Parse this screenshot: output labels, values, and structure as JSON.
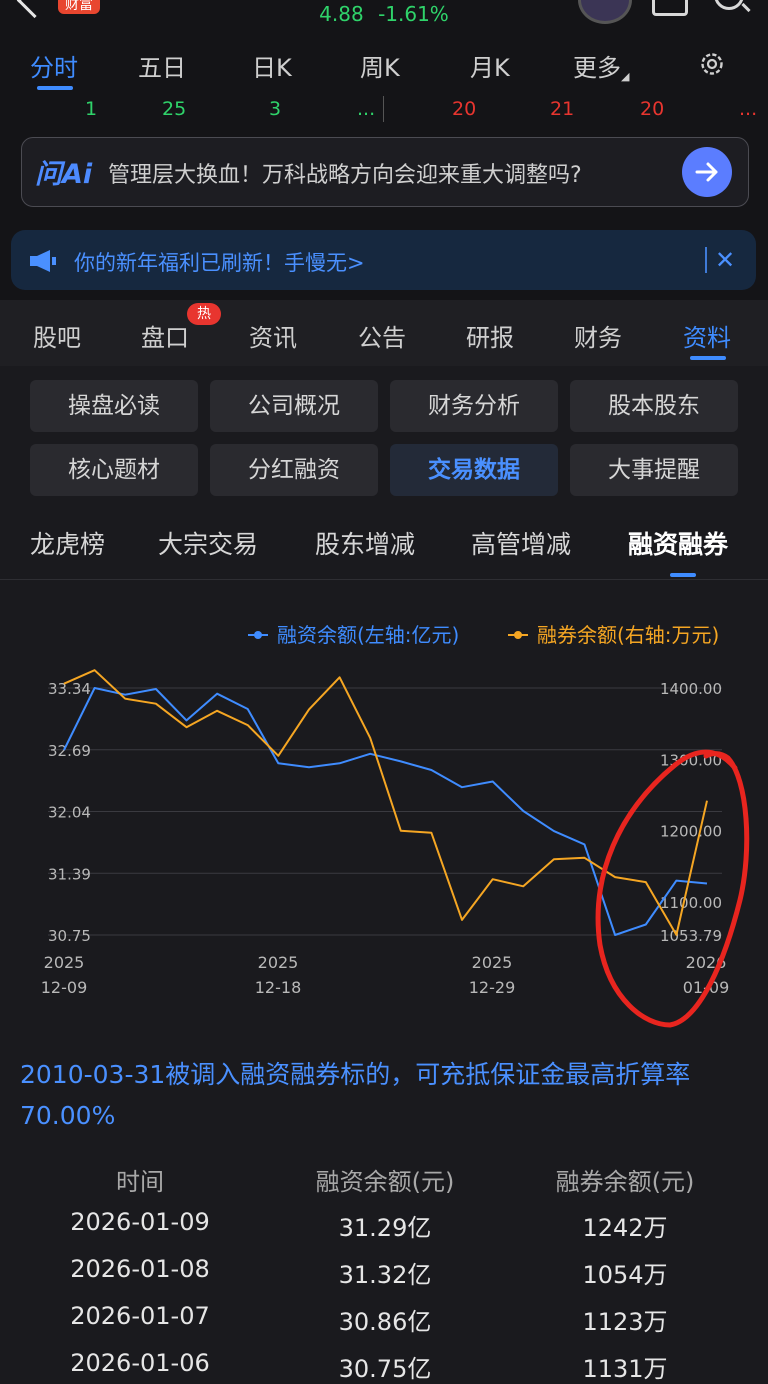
{
  "status": {
    "brand_badge": "财富",
    "price": "4.88",
    "change": "-1.61%"
  },
  "chart_tabs": {
    "items": [
      "分时",
      "五日",
      "日K",
      "周K",
      "月K",
      "更多"
    ],
    "active": "分时"
  },
  "numbers_row": {
    "left": [
      "1",
      "25",
      "3",
      "..."
    ],
    "right": [
      "20",
      "21",
      "20",
      "..."
    ]
  },
  "ai_bar": {
    "logo": "问Ai",
    "question": "管理层大换血！万科战略方向会迎来重大调整吗?"
  },
  "notice": {
    "text": "你的新年福利已刷新！手慢无>"
  },
  "content_tabs": {
    "items": [
      "股吧",
      "盘口",
      "资讯",
      "公告",
      "研报",
      "财务",
      "资料"
    ],
    "active": "资料",
    "hot_badge": "热"
  },
  "grid_buttons": {
    "row1": [
      "操盘必读",
      "公司概况",
      "财务分析",
      "股本股东"
    ],
    "row2": [
      "核心题材",
      "分红融资",
      "交易数据",
      "大事提醒"
    ],
    "active": "交易数据"
  },
  "sub_tabs": {
    "items": [
      "龙虎榜",
      "大宗交易",
      "股东增减",
      "高管增减",
      "融资融券"
    ],
    "active": "融资融券"
  },
  "chart_data": {
    "type": "line",
    "legend": [
      {
        "name": "融资余额(左轴:亿元)",
        "color": "#3f8cff"
      },
      {
        "name": "融券余额(右轴:万元)",
        "color": "#f5a623"
      }
    ],
    "x_labels": [
      [
        "2025",
        "12-09"
      ],
      [
        "2025",
        "12-18"
      ],
      [
        "2025",
        "12-29"
      ],
      [
        "2026",
        "01-09"
      ]
    ],
    "left_axis": {
      "ticks": [
        "33.34",
        "32.69",
        "32.04",
        "31.39",
        "30.75"
      ],
      "ylim": [
        30.75,
        33.34
      ]
    },
    "right_axis": {
      "ticks": [
        "1400.00",
        "1300.00",
        "1200.00",
        "1100.00",
        "1053.79"
      ],
      "ylim": [
        1053.79,
        1400.0
      ]
    },
    "series": [
      {
        "name": "融资余额(左轴:亿元)",
        "axis": "left",
        "values": [
          32.69,
          33.34,
          33.27,
          33.33,
          33.0,
          33.28,
          33.12,
          32.55,
          32.51,
          32.55,
          32.65,
          32.57,
          32.48,
          32.3,
          32.36,
          32.05,
          31.84,
          31.7,
          30.75,
          30.86,
          31.32,
          31.29
        ]
      },
      {
        "name": "融券余额(右轴:万元)",
        "axis": "right",
        "values": [
          1406,
          1425,
          1385,
          1378,
          1345,
          1368,
          1348,
          1305,
          1370,
          1415,
          1330,
          1200,
          1197,
          1075,
          1132,
          1122,
          1160,
          1162,
          1135,
          1128,
          1054,
          1242
        ]
      }
    ],
    "annotation": "red freehand circle around the latest data points"
  },
  "note": {
    "text": "2010-03-31被调入融资融券标的，可充抵保证金最高折算率70.00%"
  },
  "table": {
    "headers": [
      "时间",
      "融资余额(元)",
      "融券余额(元)"
    ],
    "rows": [
      [
        "2026-01-09",
        "31.29亿",
        "1242万"
      ],
      [
        "2026-01-08",
        "31.32亿",
        "1054万"
      ],
      [
        "2026-01-07",
        "30.86亿",
        "1123万"
      ],
      [
        "2026-01-06",
        "30.75亿",
        "1131万"
      ]
    ]
  },
  "colors": {
    "accent": "#3f8cff",
    "up": "#e8352f",
    "down": "#2fd36a",
    "short_line": "#f5a623",
    "circle": "#e8251f"
  }
}
